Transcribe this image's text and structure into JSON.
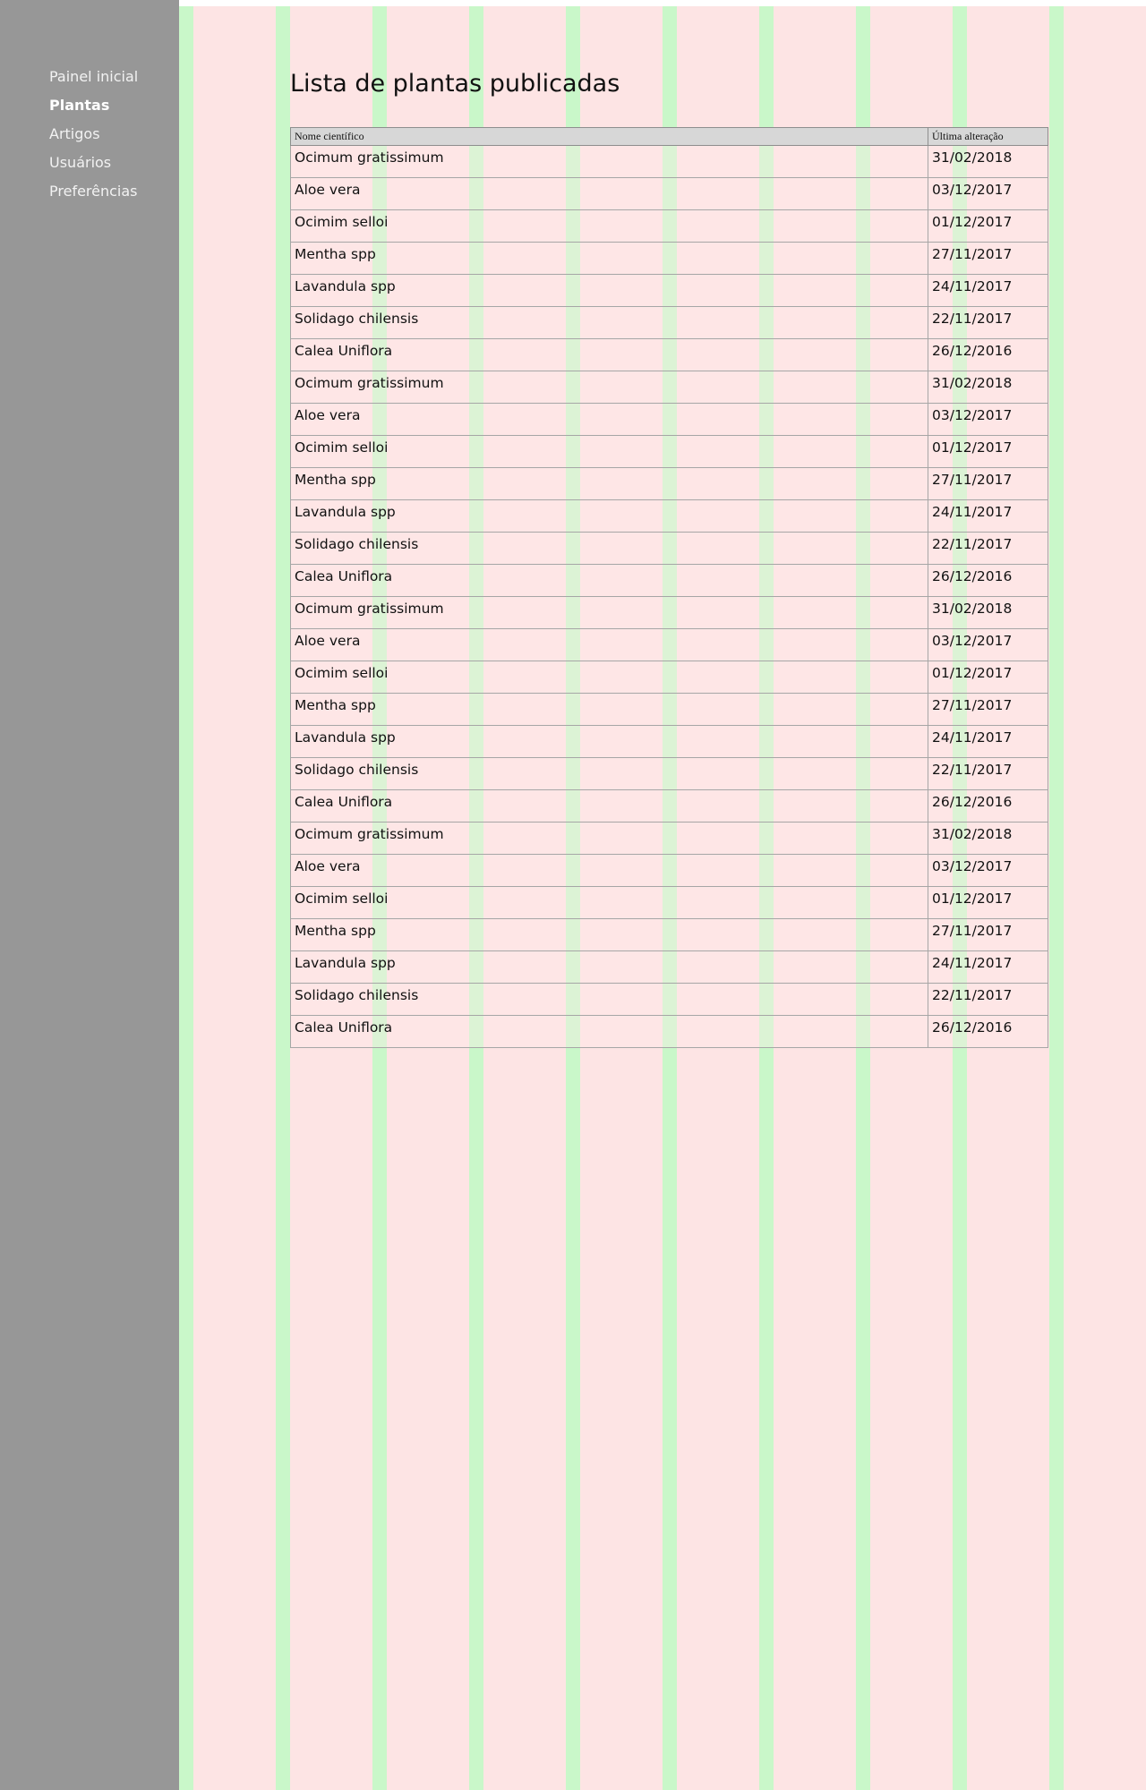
{
  "sidebar": {
    "items": [
      {
        "label": "Painel inicial",
        "active": false
      },
      {
        "label": "Plantas",
        "active": true
      },
      {
        "label": "Artigos",
        "active": false
      },
      {
        "label": "Usuários",
        "active": false
      },
      {
        "label": "Preferências",
        "active": false
      }
    ]
  },
  "main": {
    "title": "Lista de plantas publicadas",
    "table": {
      "headers": [
        "Nome científico",
        "Última alteração"
      ],
      "rows": [
        [
          "Ocimum gratissimum",
          "31/02/2018"
        ],
        [
          "Aloe vera",
          "03/12/2017"
        ],
        [
          "Ocimim selloi",
          "01/12/2017"
        ],
        [
          "Mentha spp",
          "27/11/2017"
        ],
        [
          "Lavandula spp",
          "24/11/2017"
        ],
        [
          "Solidago chilensis",
          "22/11/2017"
        ],
        [
          "Calea Uniflora",
          "26/12/2016"
        ],
        [
          "Ocimum gratissimum",
          "31/02/2018"
        ],
        [
          "Aloe vera",
          "03/12/2017"
        ],
        [
          "Ocimim selloi",
          "01/12/2017"
        ],
        [
          "Mentha spp",
          "27/11/2017"
        ],
        [
          "Lavandula spp",
          "24/11/2017"
        ],
        [
          "Solidago chilensis",
          "22/11/2017"
        ],
        [
          "Calea Uniflora",
          "26/12/2016"
        ],
        [
          "Ocimum gratissimum",
          "31/02/2018"
        ],
        [
          "Aloe vera",
          "03/12/2017"
        ],
        [
          "Ocimim selloi",
          "01/12/2017"
        ],
        [
          "Mentha spp",
          "27/11/2017"
        ],
        [
          "Lavandula spp",
          "24/11/2017"
        ],
        [
          "Solidago chilensis",
          "22/11/2017"
        ],
        [
          "Calea Uniflora",
          "26/12/2016"
        ],
        [
          "Ocimum gratissimum",
          "31/02/2018"
        ],
        [
          "Aloe vera",
          "03/12/2017"
        ],
        [
          "Ocimim selloi",
          "01/12/2017"
        ],
        [
          "Mentha spp",
          "27/11/2017"
        ],
        [
          "Lavandula spp",
          "24/11/2017"
        ],
        [
          "Solidago chilensis",
          "22/11/2017"
        ],
        [
          "Calea Uniflora",
          "26/12/2016"
        ]
      ]
    }
  },
  "colors": {
    "sidebar_bg": "#979797",
    "grid_column": "#fde4e4",
    "grid_gutter": "#c9f7c9",
    "table_header_bg": "#d7d7d7"
  }
}
